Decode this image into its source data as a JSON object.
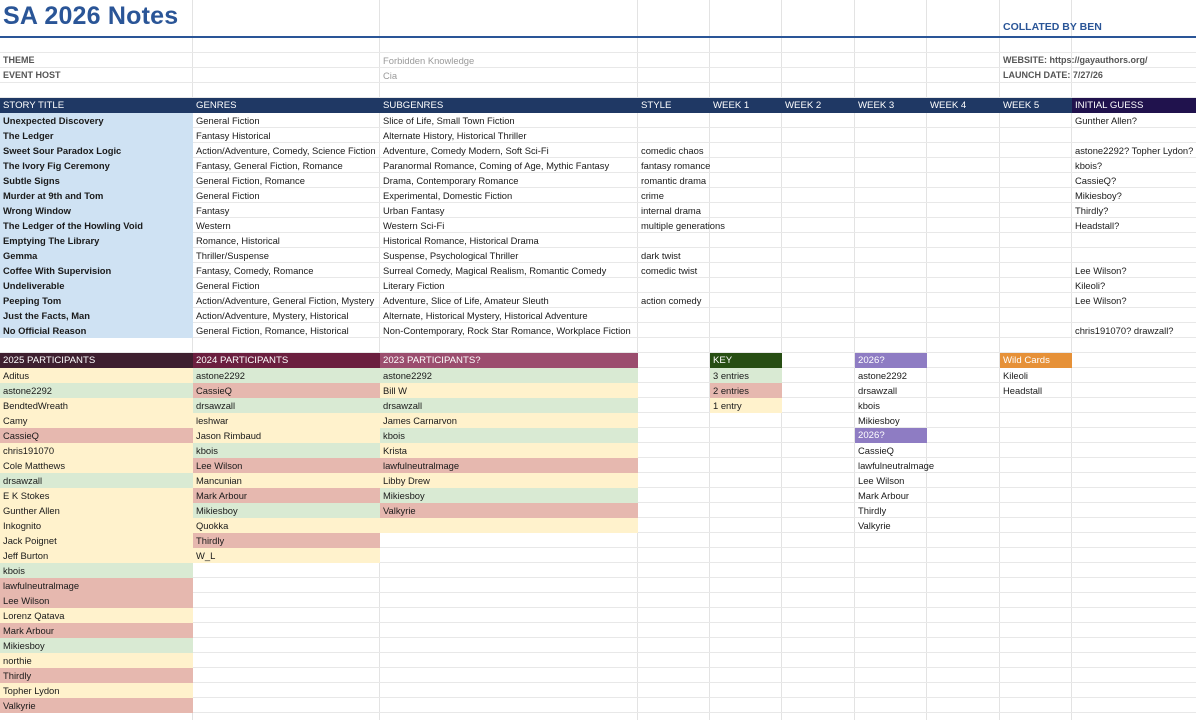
{
  "title": "SA 2026 Notes",
  "collated": "COLLATED BY BEN",
  "meta": {
    "theme_label": "THEME",
    "theme_value": "Forbidden Knowledge",
    "host_label": "EVENT HOST",
    "host_value": "Cia",
    "website": "WEBSITE: https://gayauthors.org/",
    "launch": "LAUNCH DATE: 7/27/26"
  },
  "colors": {
    "title_blue": "#2a5597",
    "header_navy": "#1f3864",
    "header_dark_purple": "#20124d",
    "story_blue": "#cfe2f3",
    "p2025": "#3e1f2f",
    "p2024": "#6b1f3f",
    "p2023": "#9b4d6e",
    "key": "#274e13",
    "g2026": "#8e7cc3",
    "wild": "#e69138",
    "green": "#d9ead3",
    "red": "#e6b8af",
    "yellow": "#fff2cc"
  },
  "story_headers": [
    "STORY TITLE",
    "GENRES",
    "SUBGENRES",
    "STYLE",
    "WEEK 1",
    "WEEK 2",
    "WEEK 3",
    "WEEK 4",
    "WEEK 5",
    "INITIAL GUESS"
  ],
  "stories": [
    {
      "title": "Unexpected Discovery",
      "genres": "General Fiction",
      "subgenres": "Slice of Life, Small Town Fiction",
      "style": "",
      "guess": "Gunther Allen?"
    },
    {
      "title": "The Ledger",
      "genres": "Fantasy Historical",
      "subgenres": "Alternate History, Historical Thriller",
      "style": "",
      "guess": ""
    },
    {
      "title": "Sweet Sour Paradox Logic",
      "genres": "Action/Adventure, Comedy, Science Fiction",
      "subgenres": "Adventure, Comedy Modern, Soft Sci-Fi",
      "style": "comedic chaos",
      "guess": "astone2292? Topher Lydon?"
    },
    {
      "title": "The Ivory Fig Ceremony",
      "genres": "Fantasy, General Fiction, Romance",
      "subgenres": "Paranormal Romance, Coming of Age, Mythic Fantasy",
      "style": "fantasy romance",
      "guess": "kbois?"
    },
    {
      "title": "Subtle Signs",
      "genres": "General Fiction, Romance",
      "subgenres": "Drama, Contemporary Romance",
      "style": "romantic drama",
      "guess": "CassieQ?"
    },
    {
      "title": "Murder at 9th and Tom",
      "genres": "General Fiction",
      "subgenres": "Experimental, Domestic Fiction",
      "style": "crime",
      "guess": "Mikiesboy?"
    },
    {
      "title": "Wrong Window",
      "genres": "Fantasy",
      "subgenres": "Urban Fantasy",
      "style": "internal drama",
      "guess": "Thirdly?"
    },
    {
      "title": "The Ledger of the Howling Void",
      "genres": "Western",
      "subgenres": "Western Sci-Fi",
      "style": "multiple generations",
      "guess": "Headstall?"
    },
    {
      "title": "Emptying The Library",
      "genres": "Romance, Historical",
      "subgenres": "Historical Romance, Historical Drama",
      "style": "",
      "guess": ""
    },
    {
      "title": "Gemma",
      "genres": "Thriller/Suspense",
      "subgenres": "Suspense, Psychological Thriller",
      "style": "dark twist",
      "guess": ""
    },
    {
      "title": "Coffee With Supervision",
      "genres": "Fantasy, Comedy, Romance",
      "subgenres": "Surreal Comedy, Magical Realism, Romantic Comedy",
      "style": "comedic twist",
      "guess": "Lee Wilson?"
    },
    {
      "title": "Undeliverable",
      "genres": "General Fiction",
      "subgenres": "Literary Fiction",
      "style": "",
      "guess": "Kileoli?"
    },
    {
      "title": "Peeping Tom",
      "genres": "Action/Adventure, General Fiction, Mystery",
      "subgenres": "Adventure, Slice of Life, Amateur Sleuth",
      "style": "action comedy",
      "guess": "Lee Wilson?"
    },
    {
      "title": "Just the Facts, Man",
      "genres": "Action/Adventure, Mystery, Historical",
      "subgenres": "Alternate, Historical Mystery, Historical Adventure",
      "style": "",
      "guess": ""
    },
    {
      "title": "No Official Reason",
      "genres": "General Fiction, Romance, Historical",
      "subgenres": "Non-Contemporary, Rock Star Romance, Workplace Fiction",
      "style": "",
      "guess": "chris191070? drawzall?"
    }
  ],
  "participants": {
    "h2025": "2025 PARTICIPANTS",
    "h2024": "2024 PARTICIPANTS",
    "h2023": "2023 PARTICIPANTS?",
    "p2025": [
      {
        "n": "Aditus",
        "c": "yellow"
      },
      {
        "n": "astone2292",
        "c": "green"
      },
      {
        "n": "BendtedWreath",
        "c": "yellow"
      },
      {
        "n": "Camy",
        "c": "yellow"
      },
      {
        "n": "CassieQ",
        "c": "red"
      },
      {
        "n": "chris191070",
        "c": "yellow"
      },
      {
        "n": "Cole Matthews",
        "c": "yellow"
      },
      {
        "n": "drsawzall",
        "c": "green"
      },
      {
        "n": "E K Stokes",
        "c": "yellow"
      },
      {
        "n": "Gunther Allen",
        "c": "yellow"
      },
      {
        "n": "Inkognito",
        "c": "yellow"
      },
      {
        "n": "Jack Poignet",
        "c": "yellow"
      },
      {
        "n": "Jeff Burton",
        "c": "yellow"
      },
      {
        "n": "kbois",
        "c": "green"
      },
      {
        "n": "lawfulneutralmage",
        "c": "red"
      },
      {
        "n": "Lee Wilson",
        "c": "red"
      },
      {
        "n": "Lorenz Qatava",
        "c": "yellow"
      },
      {
        "n": "Mark Arbour",
        "c": "red"
      },
      {
        "n": "Mikiesboy",
        "c": "green"
      },
      {
        "n": "northie",
        "c": "yellow"
      },
      {
        "n": "Thirdly",
        "c": "red"
      },
      {
        "n": "Topher Lydon",
        "c": "yellow"
      },
      {
        "n": "Valkyrie",
        "c": "red"
      }
    ],
    "p2024": [
      {
        "n": "astone2292",
        "c": "green"
      },
      {
        "n": "CassieQ",
        "c": "red"
      },
      {
        "n": "drsawzall",
        "c": "green"
      },
      {
        "n": "leshwar",
        "c": "yellow"
      },
      {
        "n": "Jason Rimbaud",
        "c": "yellow"
      },
      {
        "n": "kbois",
        "c": "green"
      },
      {
        "n": "Lee Wilson",
        "c": "red"
      },
      {
        "n": "Mancunian",
        "c": "yellow"
      },
      {
        "n": "Mark Arbour",
        "c": "red"
      },
      {
        "n": "Mikiesboy",
        "c": "green"
      },
      {
        "n": "Quokka",
        "c": "yellow"
      },
      {
        "n": "Thirdly",
        "c": "red"
      },
      {
        "n": "W_L",
        "c": "yellow"
      }
    ],
    "p2023": [
      {
        "n": "astone2292",
        "c": "green"
      },
      {
        "n": "Bill W",
        "c": "yellow"
      },
      {
        "n": "drsawzall",
        "c": "green"
      },
      {
        "n": "James Carnarvon",
        "c": "yellow"
      },
      {
        "n": "kbois",
        "c": "green"
      },
      {
        "n": "Krista",
        "c": "yellow"
      },
      {
        "n": "lawfulneutralmage",
        "c": "red"
      },
      {
        "n": "Libby Drew",
        "c": "yellow"
      },
      {
        "n": "Mikiesboy",
        "c": "green"
      },
      {
        "n": "Valkyrie",
        "c": "red"
      },
      {
        "n": "",
        "c": "yellow"
      }
    ]
  },
  "key": {
    "header": "KEY",
    "items": [
      {
        "n": "3 entries",
        "c": "green"
      },
      {
        "n": "2 entries",
        "c": "red"
      },
      {
        "n": "1 entry",
        "c": "yellow"
      }
    ]
  },
  "g2026": {
    "header1": "2026?",
    "list1": [
      "astone2292",
      "drsawzall",
      "kbois",
      "Mikiesboy"
    ],
    "header2": "2026?",
    "list2": [
      "CassieQ",
      "lawfulneutralmage",
      "Lee Wilson",
      "Mark Arbour",
      "Thirdly",
      "Valkyrie"
    ]
  },
  "wild": {
    "header": "Wild Cards",
    "list": [
      "Kileoli",
      "Headstall"
    ]
  }
}
